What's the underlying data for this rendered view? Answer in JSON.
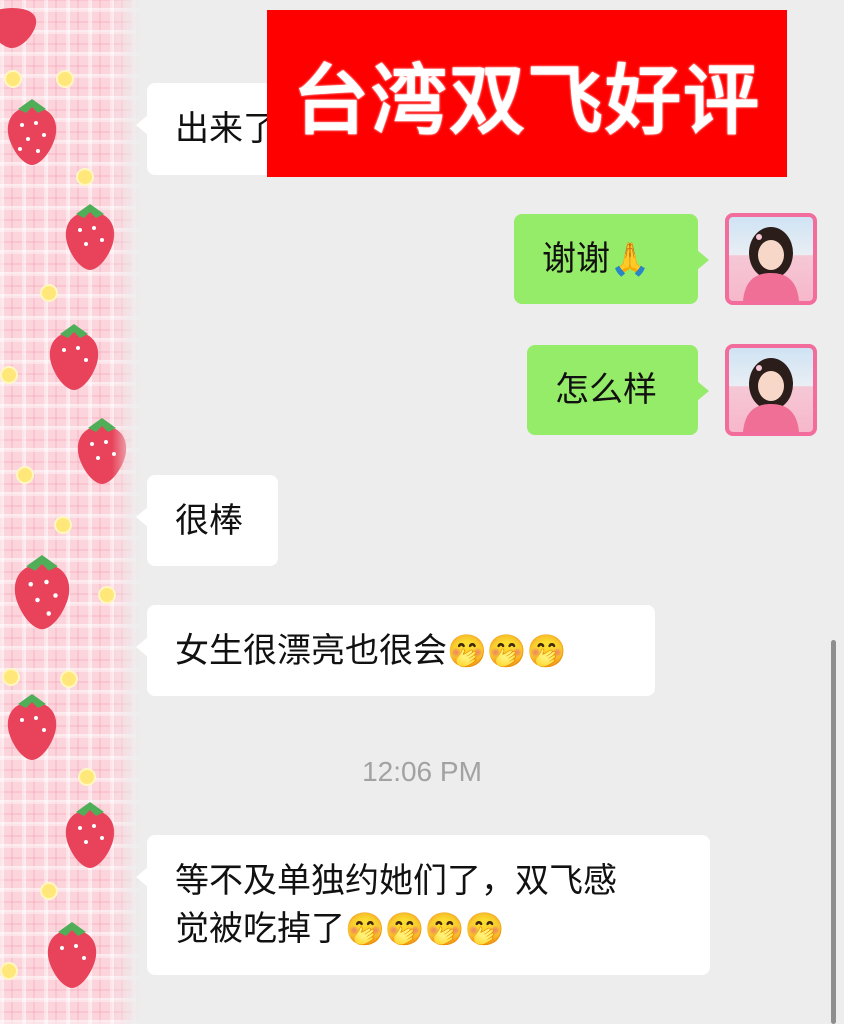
{
  "banner": {
    "title": "台湾双飞好评"
  },
  "messages": [
    {
      "sender": "contact",
      "text": "出来了"
    },
    {
      "sender": "me",
      "text": "谢谢",
      "emoji": "🙏"
    },
    {
      "sender": "me",
      "text": "怎么样"
    },
    {
      "sender": "contact",
      "text": "很棒"
    },
    {
      "sender": "contact",
      "text": "女生很漂亮也很会",
      "emoji": "🤭🤭🤭"
    },
    {
      "sender": "contact",
      "line1": "等不及单独约她们了，双飞感",
      "line2": "觉被吃掉了",
      "emoji": "🤭🤭🤭🤭"
    }
  ],
  "timestamp": "12:06 PM",
  "colors": {
    "incoming_bubble": "#ffffff",
    "outgoing_bubble": "#95ec69",
    "banner_bg": "#ff0000",
    "avatar_border": "#f26c9c",
    "chat_bg": "#ededed"
  },
  "icons": [
    "strawberry-pattern",
    "user-avatar"
  ]
}
